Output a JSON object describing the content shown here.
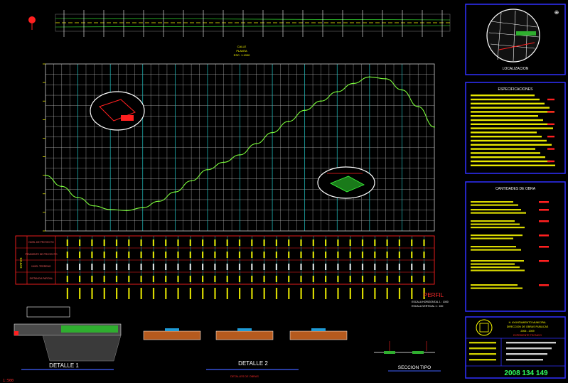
{
  "colors": {
    "background": "#000000",
    "grid_line": "#cfcfcf",
    "grid_cyan": "#22c5c5",
    "profile_line": "#7cfc3c",
    "table_border": "#ff2020",
    "panel_border": "#3030ff",
    "panel_text": "#ffff00",
    "label_text": "#ffff00",
    "title_red": "#ff2a2a",
    "station_green": "#3cff3c",
    "big_number": "#30ff60"
  },
  "plan": {
    "title_line1": "CALLE ",
    "title_line2": "PLANTA",
    "title_line3": "ESC. 1:1000"
  },
  "table": {
    "side_label": "DATOS",
    "row_labels": [
      "NIVEL DE PROYECTO",
      "PENDIENTE DE PROYECTO",
      "NIVEL TERRENO",
      "DISTANCIA PARCIAL"
    ]
  },
  "profile": {
    "title": "PERFIL",
    "scale_h": "ESCALA HORIZONTAL 1 : 1000",
    "scale_v": "ESCALA VERTICAL   1 : 100"
  },
  "details": {
    "detalle1": "DETALLE 1",
    "detalle2": "DETALLE 2",
    "seccion": "SECCION TIPO",
    "bottom_caption": "DETALLES DE OBRAS",
    "corner_scale": "1:500"
  },
  "panels": {
    "location_title": "LOCALIZACION",
    "specs_title": "ESPECIFICACIONES",
    "quantities_title": "CANTIDADES DE OBRA",
    "title_block_line1": "H. AYUNTAMIENTO MUNICIPAL",
    "title_block_line2": "DIRECCION DE OBRAS PUBLICAS",
    "title_block_line3": "2006 - 2009",
    "title_block_line4": "EXPEDIENTE TECNICO",
    "project_number": "2008 134 149"
  },
  "chart_data": {
    "type": "line",
    "x": [
      0,
      1,
      2,
      3,
      4,
      5,
      6,
      7,
      8,
      9,
      10,
      11,
      12,
      13,
      14,
      15,
      16,
      17,
      18,
      19,
      20,
      21,
      22,
      23,
      24
    ],
    "series": [
      {
        "values": [
          2.0,
          1.4,
          0.8,
          0.35,
          0.15,
          0.1,
          0.25,
          0.6,
          1.1,
          1.7,
          2.3,
          2.7,
          3.1,
          3.7,
          4.3,
          4.9,
          5.5,
          6.0,
          6.5,
          6.95,
          7.3,
          7.2,
          6.6,
          5.7,
          4.6
        ]
      }
    ],
    "xlim": [
      0,
      24
    ],
    "ylim": [
      -1,
      8
    ],
    "grid": true,
    "legend": "none"
  }
}
